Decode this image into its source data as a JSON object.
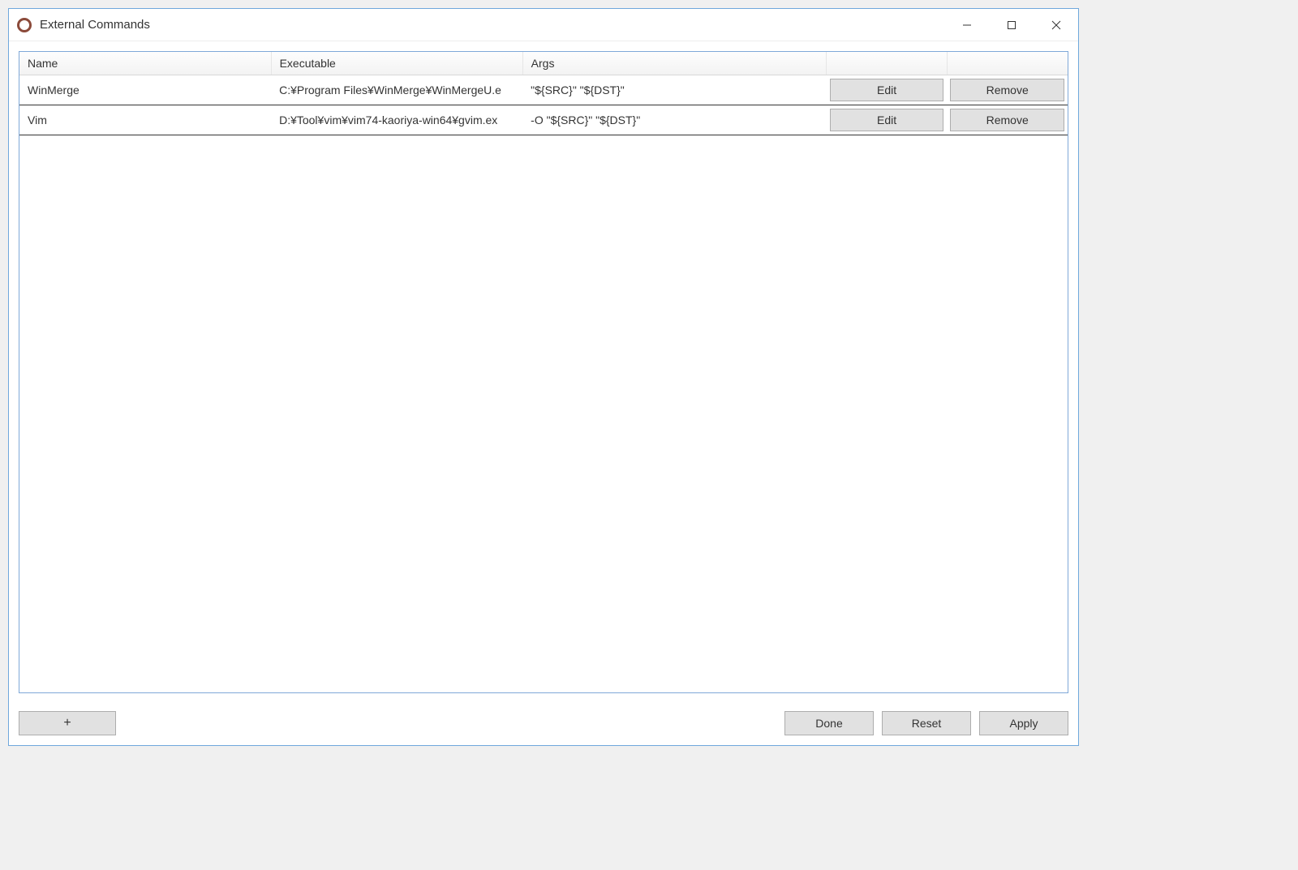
{
  "window": {
    "title": "External Commands"
  },
  "table": {
    "headers": {
      "name": "Name",
      "executable": "Executable",
      "args": "Args"
    },
    "rows": [
      {
        "name": "WinMerge",
        "executable": "C:¥Program Files¥WinMerge¥WinMergeU.e",
        "args": "\"${SRC}\" \"${DST}\"",
        "edit_label": "Edit",
        "remove_label": "Remove"
      },
      {
        "name": "Vim",
        "executable": "D:¥Tool¥vim¥vim74-kaoriya-win64¥gvim.ex",
        "args": "-O \"${SRC}\" \"${DST}\"",
        "edit_label": "Edit",
        "remove_label": "Remove"
      }
    ]
  },
  "footer": {
    "add_label": "+",
    "done_label": "Done",
    "reset_label": "Reset",
    "apply_label": "Apply"
  }
}
